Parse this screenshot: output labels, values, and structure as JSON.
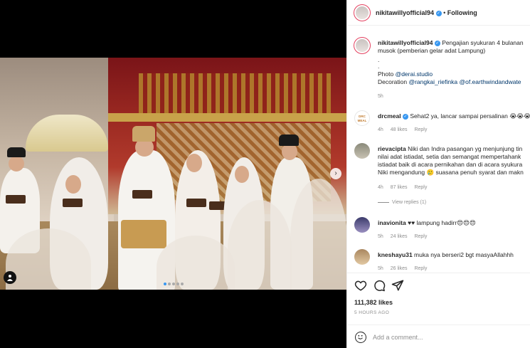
{
  "header": {
    "username": "nikitawillyofficial94",
    "separator": "•",
    "follow_label": "Following"
  },
  "caption": {
    "username": "nikitawillyofficial94",
    "line1": "Pengajian syukuran 4 bulanan",
    "line2": "musok (pemberian gelar adat Lampung)",
    "dot1": ".",
    "dot2": ".",
    "photo_prefix": "Photo ",
    "photo_handle": "@derai.studio",
    "decoration_prefix": "Decoration ",
    "decoration_handles": "@rangkai_riefinka @of.earthwindandwate",
    "time": "5h"
  },
  "comments": [
    {
      "username": "drcmeal",
      "avatar_text": "DRC MEAL",
      "text": "Sehat2 ya, lancar sampai persalinan 😭😭😭",
      "time": "4h",
      "likes": "48 likes",
      "reply": "Reply"
    },
    {
      "username": "rievacipta",
      "line1": "Niki dan Indra pasangan yg menjunjung tin",
      "line2": "nilai adat istiadat, setia dan semangat mempertahank",
      "line3": "istiadat baik di acara pernikahan dan di acara syukura",
      "line4": "Niki mengandung 🥲 suasana penuh syarat dan makn",
      "time": "4h",
      "likes": "87 likes",
      "reply": "Reply",
      "view_replies": "View replies (1)"
    },
    {
      "username": "inavionita",
      "text": "♥♥ lampung hadirr😍😍😍",
      "time": "5h",
      "likes": "24 likes",
      "reply": "Reply"
    },
    {
      "username": "kneshayu31",
      "text": "muka nya berseri2 bgt masyaAllahhh",
      "time": "5h",
      "likes": "26 likes",
      "reply": "Reply"
    }
  ],
  "footer": {
    "likes": "111,382 likes",
    "time": "5 HOURS AGO",
    "add_comment_placeholder": "Add a comment..."
  },
  "carousel": {
    "slide_count": 5,
    "active_index": 0
  },
  "icons": {
    "like": "heart-icon",
    "comment": "comment-icon",
    "share": "share-icon",
    "next": "chevron-right-icon",
    "tags": "user-tag-icon",
    "emoji": "emoji-icon"
  },
  "colors": {
    "verified": "#3897f0",
    "carousel_active": "#3897f0",
    "muted": "#8e8e8e",
    "link": "#00376b"
  }
}
